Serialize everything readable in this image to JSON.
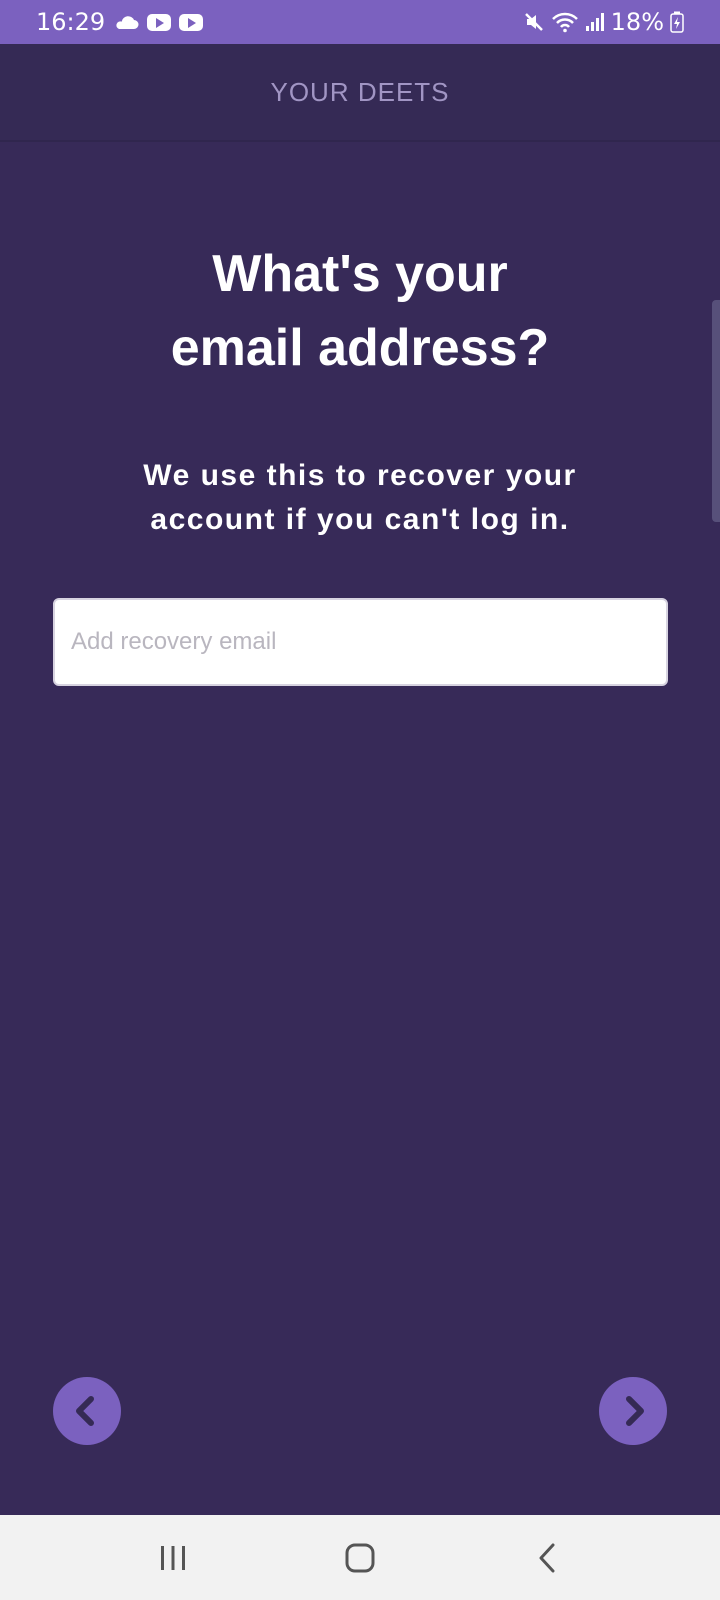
{
  "status_bar": {
    "time": "16:29",
    "battery": "18%",
    "icons": [
      "cloud-icon",
      "youtube-icon",
      "youtube-icon",
      "mute-icon",
      "wifi-icon",
      "signal-icon",
      "battery-charging-icon"
    ]
  },
  "header": {
    "title": "YOUR DEETS"
  },
  "main": {
    "question_line1": "What's your",
    "question_line2": "email address?",
    "subtitle_line1": "We use this to recover your",
    "subtitle_line2": "account if you can't log in.",
    "email": {
      "value": "",
      "placeholder": "Add recovery email"
    },
    "prev_icon": "chevron-left-icon",
    "next_icon": "chevron-right-icon"
  },
  "system_nav": {
    "icons": [
      "recents-icon",
      "home-icon",
      "back-icon"
    ]
  },
  "colors": {
    "background": "#372a58",
    "status_bar": "#7b61bf",
    "accent": "#7b61bf",
    "header_text": "#a195c4"
  }
}
